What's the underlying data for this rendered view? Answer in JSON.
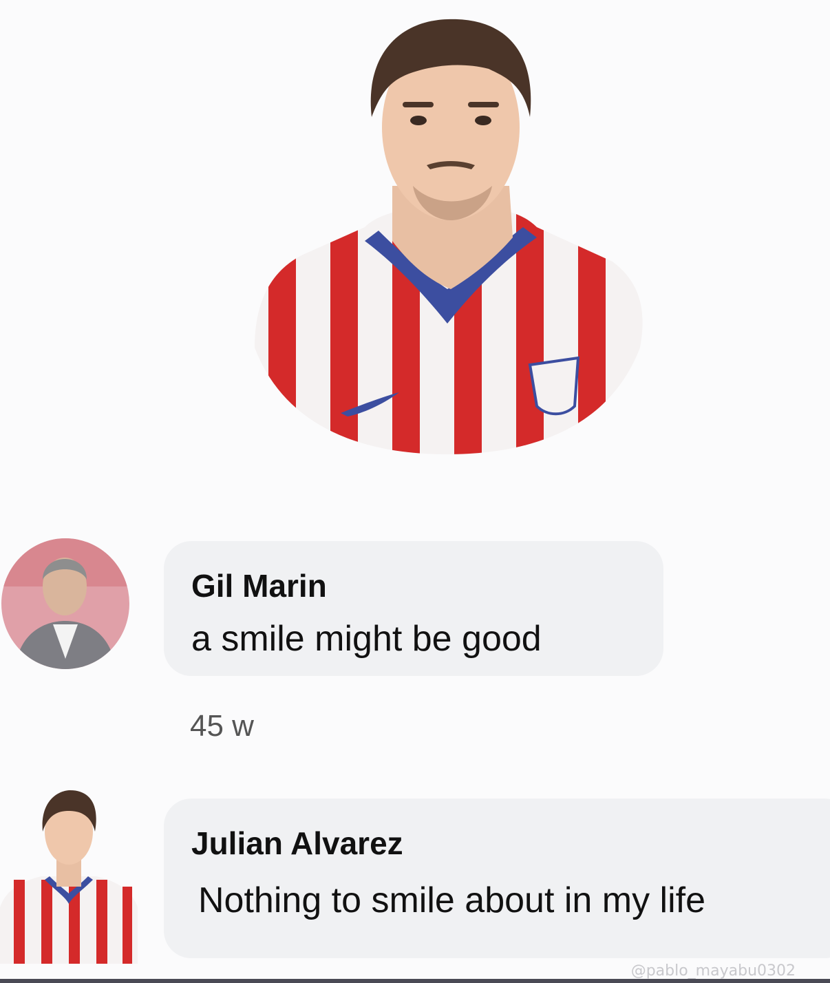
{
  "post": {
    "profile_image_alt": "Julian Alvarez profile photo"
  },
  "comments": [
    {
      "author": "Gil Marin",
      "text": "a smile might be good",
      "age": "45 w"
    },
    {
      "author": "Julian Alvarez",
      "text": "Nothing to smile about in my life"
    }
  ],
  "watermark": "@pablo_mayabu0302",
  "colors": {
    "background": "#fbfbfc",
    "bubble": "#f0f1f3",
    "jersey_red": "#d42a2a",
    "jersey_white": "#f5f2f2",
    "collar_blue": "#3c4ea0"
  }
}
